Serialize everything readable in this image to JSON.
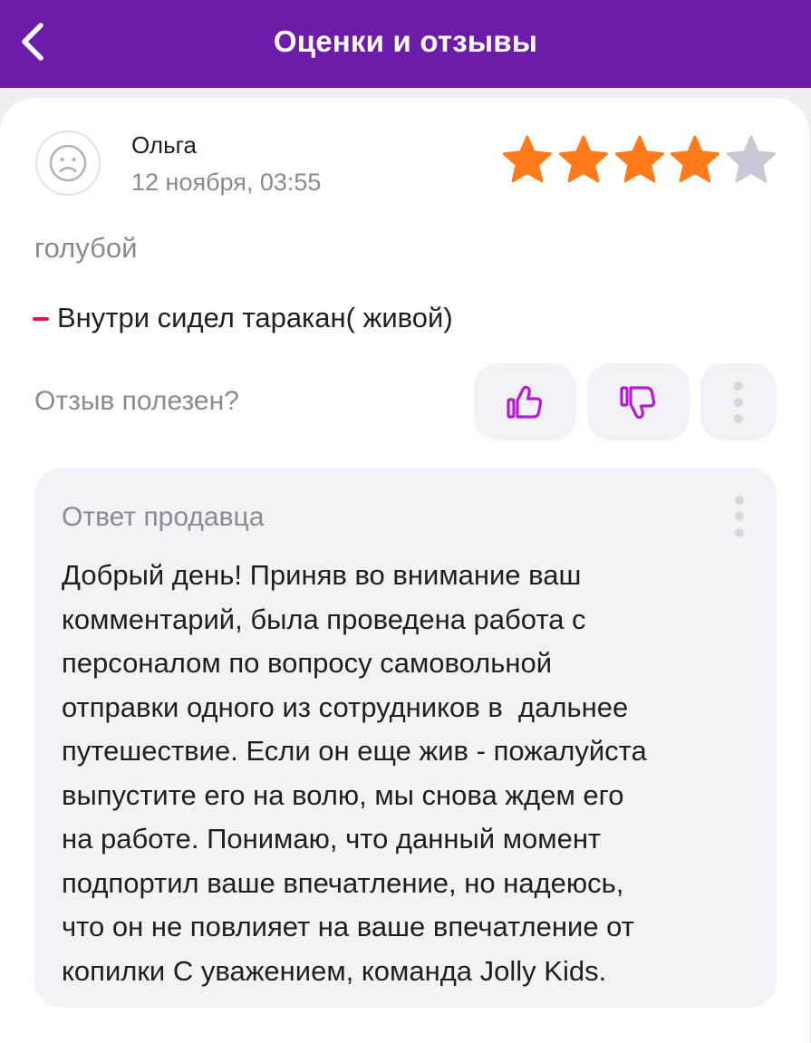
{
  "header": {
    "title": "Оценки и отзывы",
    "back_icon": "chevron-left-icon"
  },
  "colors": {
    "header_bg": "#6c1bab",
    "star_filled": "#ff7a1a",
    "star_empty": "#c9c8d6",
    "accent": "#b51bd6",
    "con_marker": "#e8114b"
  },
  "review": {
    "author": "Ольга",
    "date": "12 ноября, 03:55",
    "rating": 4,
    "rating_max": 5,
    "variant": "голубой",
    "con_text": "Внутри сидел таракан( живой)",
    "helpful_question": "Отзыв полезен?",
    "icons": {
      "avatar": "user-avatar-icon",
      "like": "thumbs-up-icon",
      "dislike": "thumbs-down-icon",
      "more": "more-vertical-icon"
    }
  },
  "seller_reply": {
    "title": "Ответ продавца",
    "lines": [
      "Добрый день! Приняв во внимание ваш",
      "комментарий, была проведена работа с",
      "персоналом по вопросу самовольной",
      "отправки одного из сотрудников в  дальнее",
      "путешествие. Если он еще жив - пожалуйста",
      "выпустите его на волю, мы снова ждем его",
      "на работе. Понимаю, что данный момент",
      "подпортил ваше впечатление, но надеюсь,",
      "что он не повлияет на ваше впечатление от",
      "копилки С уважением, команда Jolly Kids."
    ]
  }
}
